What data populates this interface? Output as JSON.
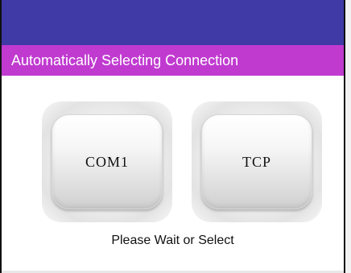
{
  "colors": {
    "title_bar": "#3f3aa6",
    "banner": "#c03ad0",
    "banner_text": "#ffffff"
  },
  "banner": {
    "text": "Automatically Selecting Connection"
  },
  "buttons": [
    {
      "label": "COM1"
    },
    {
      "label": "TCP"
    }
  ],
  "status": {
    "text": "Please Wait or Select"
  }
}
